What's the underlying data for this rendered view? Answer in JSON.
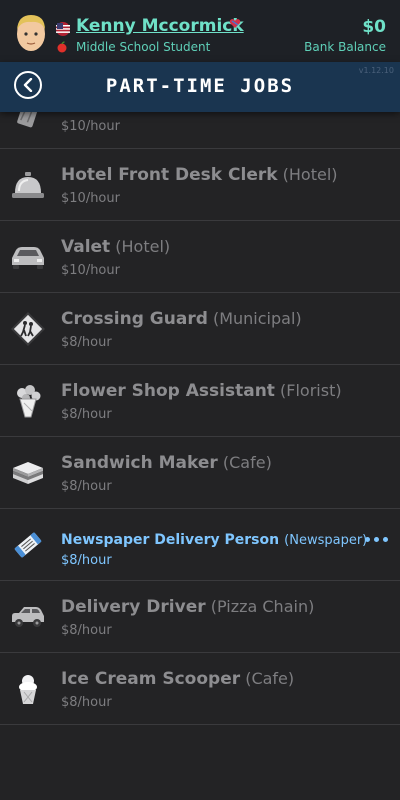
{
  "player": {
    "name": "Kenny Mccormick",
    "role": "Middle School Student",
    "balance": "$0",
    "balance_label": "Bank Balance"
  },
  "header": {
    "title": "PART-TIME JOBS",
    "version": "v1.12.10"
  },
  "jobs": [
    {
      "title": "",
      "employer": "",
      "wage": "$10/hour",
      "icon": "trash-can-icon"
    },
    {
      "title": "Hotel Front Desk Clerk",
      "employer": "(Hotel)",
      "wage": "$10/hour",
      "icon": "service-bell-icon"
    },
    {
      "title": "Valet",
      "employer": "(Hotel)",
      "wage": "$10/hour",
      "icon": "car-icon"
    },
    {
      "title": "Crossing Guard",
      "employer": "(Municipal)",
      "wage": "$8/hour",
      "icon": "school-crossing-sign-icon"
    },
    {
      "title": "Flower Shop Assistant",
      "employer": "(Florist)",
      "wage": "$8/hour",
      "icon": "bouquet-icon"
    },
    {
      "title": "Sandwich Maker",
      "employer": "(Cafe)",
      "wage": "$8/hour",
      "icon": "sandwich-icon"
    },
    {
      "title": "Newspaper Delivery Person",
      "employer": "(Newspaper)",
      "wage": "$8/hour",
      "icon": "newspaper-icon"
    },
    {
      "title": "Delivery Driver",
      "employer": "(Pizza Chain)",
      "wage": "$8/hour",
      "icon": "delivery-car-icon"
    },
    {
      "title": "Ice Cream Scooper",
      "employer": "(Cafe)",
      "wage": "$8/hour",
      "icon": "ice-cream-icon"
    }
  ],
  "colors": {
    "accent": "#6fe1c8",
    "header": "#1a3550",
    "active": "#7fc6ff",
    "background": "#232325"
  }
}
